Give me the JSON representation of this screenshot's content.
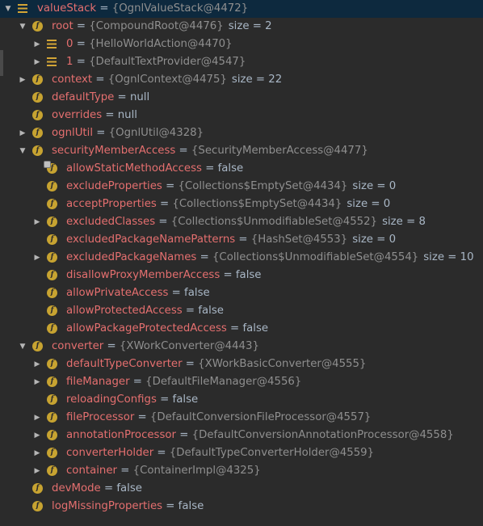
{
  "tree": [
    {
      "depth": 0,
      "toggle": "expanded",
      "icon": "array",
      "name": "valueStack",
      "value": "{OgnlValueStack@4472}",
      "size": "",
      "selected": true
    },
    {
      "depth": 1,
      "toggle": "expanded",
      "icon": "field",
      "name": "root",
      "value": "{CompoundRoot@4476}",
      "size": "size = 2"
    },
    {
      "depth": 2,
      "toggle": "collapsed",
      "icon": "array",
      "name": "0",
      "value": "{HelloWorldAction@4470}",
      "size": ""
    },
    {
      "depth": 2,
      "toggle": "collapsed",
      "icon": "array",
      "name": "1",
      "value": "{DefaultTextProvider@4547}",
      "size": ""
    },
    {
      "depth": 1,
      "toggle": "collapsed",
      "icon": "field",
      "name": "context",
      "value": "{OgnlContext@4475}",
      "size": "size = 22"
    },
    {
      "depth": 1,
      "toggle": "none",
      "icon": "field",
      "name": "defaultType",
      "value": "null",
      "size": ""
    },
    {
      "depth": 1,
      "toggle": "none",
      "icon": "field",
      "name": "overrides",
      "value": "null",
      "size": ""
    },
    {
      "depth": 1,
      "toggle": "collapsed",
      "icon": "field",
      "name": "ognlUtil",
      "value": "{OgnlUtil@4328}",
      "size": ""
    },
    {
      "depth": 1,
      "toggle": "expanded",
      "icon": "field",
      "name": "securityMemberAccess",
      "value": "{SecurityMemberAccess@4477}",
      "size": ""
    },
    {
      "depth": 2,
      "toggle": "none",
      "icon": "field-locked",
      "name": "allowStaticMethodAccess",
      "value": "false",
      "size": ""
    },
    {
      "depth": 2,
      "toggle": "none",
      "icon": "field",
      "name": "excludeProperties",
      "value": "{Collections$EmptySet@4434}",
      "size": "size = 0"
    },
    {
      "depth": 2,
      "toggle": "none",
      "icon": "field",
      "name": "acceptProperties",
      "value": "{Collections$EmptySet@4434}",
      "size": "size = 0"
    },
    {
      "depth": 2,
      "toggle": "collapsed",
      "icon": "field",
      "name": "excludedClasses",
      "value": "{Collections$UnmodifiableSet@4552}",
      "size": "size = 8"
    },
    {
      "depth": 2,
      "toggle": "none",
      "icon": "field",
      "name": "excludedPackageNamePatterns",
      "value": "{HashSet@4553}",
      "size": "size = 0"
    },
    {
      "depth": 2,
      "toggle": "collapsed",
      "icon": "field",
      "name": "excludedPackageNames",
      "value": "{Collections$UnmodifiableSet@4554}",
      "size": "size = 10"
    },
    {
      "depth": 2,
      "toggle": "none",
      "icon": "field",
      "name": "disallowProxyMemberAccess",
      "value": "false",
      "size": ""
    },
    {
      "depth": 2,
      "toggle": "none",
      "icon": "field",
      "name": "allowPrivateAccess",
      "value": "false",
      "size": ""
    },
    {
      "depth": 2,
      "toggle": "none",
      "icon": "field",
      "name": "allowProtectedAccess",
      "value": "false",
      "size": ""
    },
    {
      "depth": 2,
      "toggle": "none",
      "icon": "field",
      "name": "allowPackageProtectedAccess",
      "value": "false",
      "size": ""
    },
    {
      "depth": 1,
      "toggle": "expanded",
      "icon": "field",
      "name": "converter",
      "value": "{XWorkConverter@4443}",
      "size": ""
    },
    {
      "depth": 2,
      "toggle": "collapsed",
      "icon": "field",
      "name": "defaultTypeConverter",
      "value": "{XWorkBasicConverter@4555}",
      "size": ""
    },
    {
      "depth": 2,
      "toggle": "collapsed",
      "icon": "field",
      "name": "fileManager",
      "value": "{DefaultFileManager@4556}",
      "size": ""
    },
    {
      "depth": 2,
      "toggle": "none",
      "icon": "field",
      "name": "reloadingConfigs",
      "value": "false",
      "size": ""
    },
    {
      "depth": 2,
      "toggle": "collapsed",
      "icon": "field",
      "name": "fileProcessor",
      "value": "{DefaultConversionFileProcessor@4557}",
      "size": ""
    },
    {
      "depth": 2,
      "toggle": "collapsed",
      "icon": "field",
      "name": "annotationProcessor",
      "value": "{DefaultConversionAnnotationProcessor@4558}",
      "size": ""
    },
    {
      "depth": 2,
      "toggle": "collapsed",
      "icon": "field",
      "name": "converterHolder",
      "value": "{DefaultTypeConverterHolder@4559}",
      "size": ""
    },
    {
      "depth": 2,
      "toggle": "collapsed",
      "icon": "field",
      "name": "container",
      "value": "{ContainerImpl@4325}",
      "size": ""
    },
    {
      "depth": 1,
      "toggle": "none",
      "icon": "field",
      "name": "devMode",
      "value": "false",
      "size": ""
    },
    {
      "depth": 1,
      "toggle": "none",
      "icon": "field",
      "name": "logMissingProperties",
      "value": "false",
      "size": ""
    }
  ],
  "glyphs": {
    "expanded": "▼",
    "collapsed": "▶",
    "field": "f",
    "equals": "="
  },
  "colors": {
    "background": "#2b2b2b",
    "selection": "#0d293e",
    "field_name": "#e46f6f",
    "object_ref": "#8f8f8f",
    "field_icon": "#c7a331"
  }
}
